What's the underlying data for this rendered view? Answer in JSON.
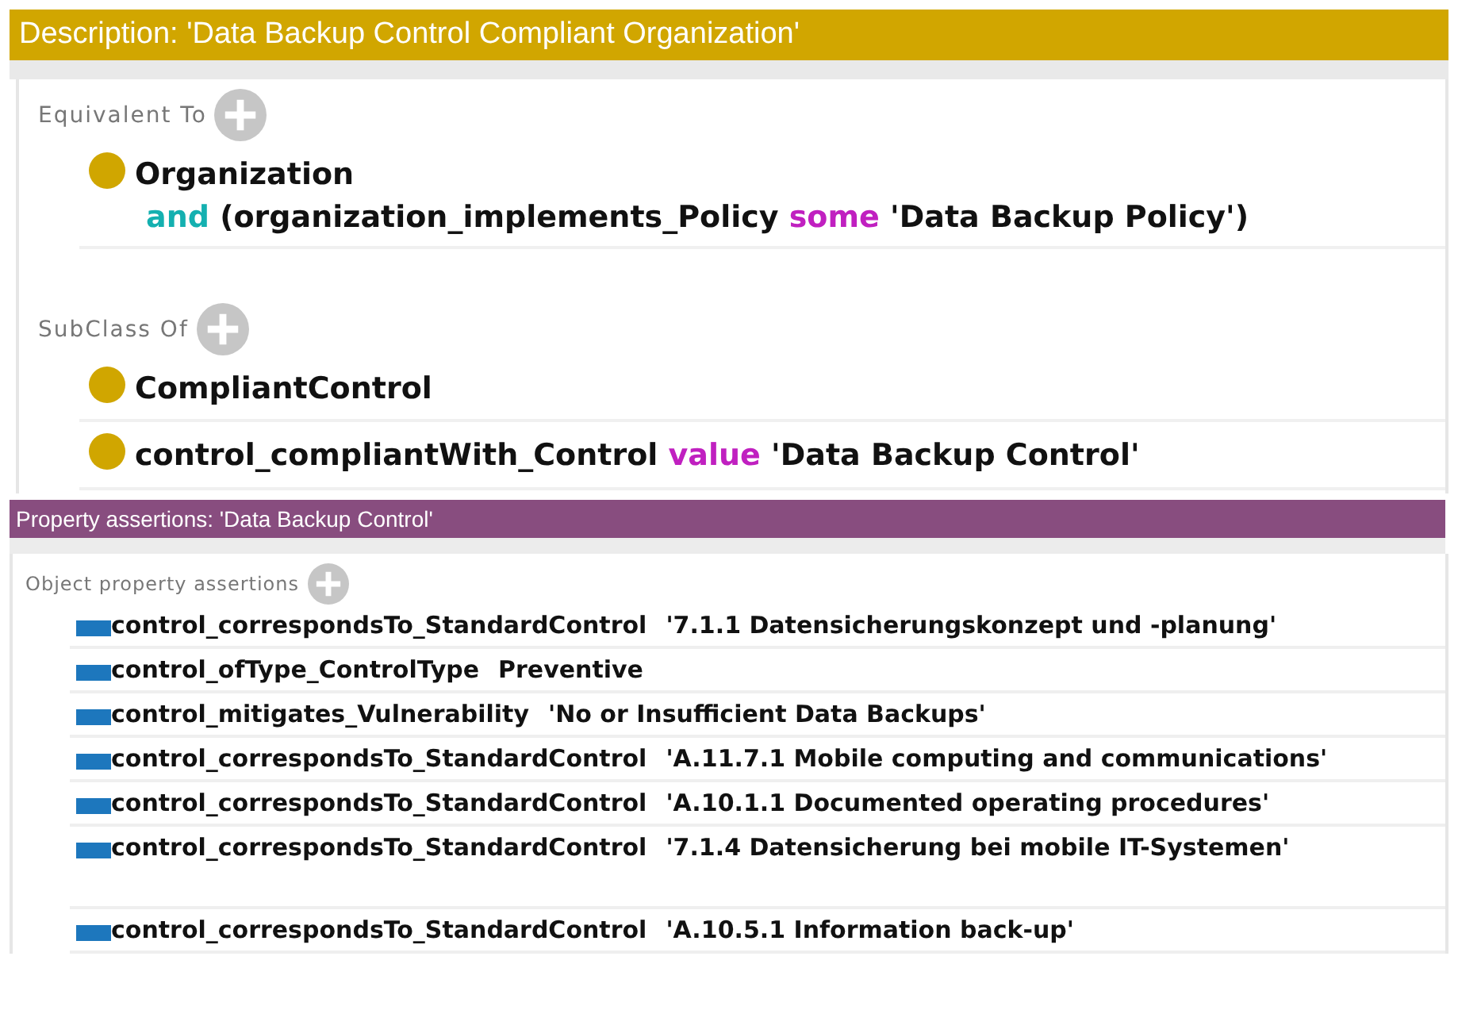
{
  "description_view": {
    "title": "Description: 'Data Backup Control Compliant Organization'",
    "sections": [
      {
        "label": "Equivalent To",
        "entries": [
          {
            "lines": [
              [
                {
                  "text": "Organization",
                  "kind": "entity"
                }
              ],
              [
                {
                  "text": "and",
                  "kind": "logical"
                },
                {
                  "text": " (organization_implements_Policy ",
                  "kind": "entity"
                },
                {
                  "text": "some",
                  "kind": "restriction"
                },
                {
                  "text": " 'Data Backup Policy')",
                  "kind": "entity"
                }
              ]
            ]
          }
        ]
      },
      {
        "label": "SubClass Of",
        "entries": [
          {
            "lines": [
              [
                {
                  "text": "CompliantControl",
                  "kind": "entity"
                }
              ]
            ]
          },
          {
            "lines": [
              [
                {
                  "text": "control_compliantWith_Control ",
                  "kind": "entity"
                },
                {
                  "text": "value",
                  "kind": "restriction"
                },
                {
                  "text": " 'Data Backup Control'",
                  "kind": "entity"
                }
              ]
            ]
          }
        ]
      }
    ]
  },
  "property_assertions_view": {
    "title": "Property assertions: 'Data Backup Control'",
    "section_label": "Object property assertions",
    "assertions": [
      {
        "property": "control_correspondsTo_StandardControl",
        "value": "'7.1.1 Datensicherungskonzept und -planung'"
      },
      {
        "property": "control_ofType_ControlType",
        "value": "Preventive"
      },
      {
        "property": "control_mitigates_Vulnerability",
        "value": "'No or Insufficient Data Backups'"
      },
      {
        "property": "control_correspondsTo_StandardControl",
        "value": "'A.11.7.1 Mobile computing and communications'"
      },
      {
        "property": "control_correspondsTo_StandardControl",
        "value": "'A.10.1.1 Documented operating procedures'"
      },
      {
        "property": "control_correspondsTo_StandardControl",
        "value": "'7.1.4 Datensicherung bei mobile IT-Systemen'"
      },
      {
        "property": "control_correspondsTo_StandardControl",
        "value": "'A.10.5.1 Information back-up'"
      }
    ]
  }
}
